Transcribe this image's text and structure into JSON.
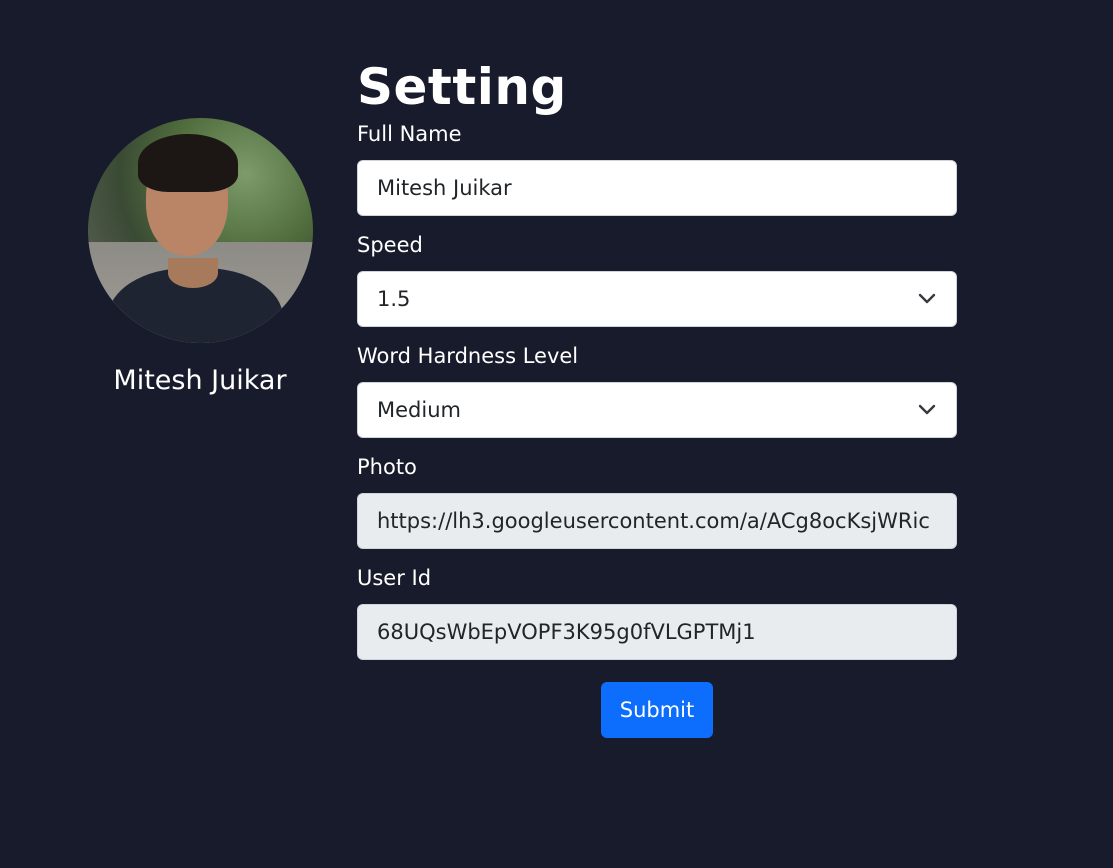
{
  "profile": {
    "name": "Mitesh Juikar"
  },
  "form": {
    "title": "Setting",
    "fields": {
      "full_name": {
        "label": "Full Name",
        "value": "Mitesh Juikar"
      },
      "speed": {
        "label": "Speed",
        "value": "1.5"
      },
      "word_hardness": {
        "label": "Word Hardness Level",
        "value": "Medium"
      },
      "photo": {
        "label": "Photo",
        "value": "https://lh3.googleusercontent.com/a/ACg8ocKsjWRic"
      },
      "user_id": {
        "label": "User Id",
        "value": "68UQsWbEpVOPF3K95g0fVLGPTMj1"
      }
    },
    "submit_label": "Submit"
  },
  "icons": {
    "select_arrow": "chevron-down-icon"
  },
  "colors": {
    "background": "#181b2c",
    "primary": "#0d6efd",
    "readonly_field": "#e9ecef"
  }
}
